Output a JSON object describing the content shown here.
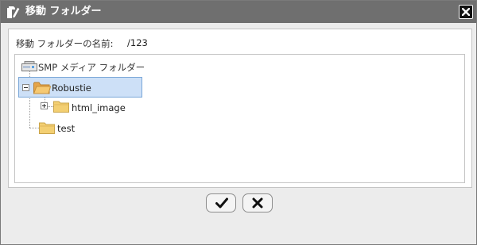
{
  "dialog": {
    "title": "移動 フォルダー",
    "name_label": "移動 フォルダーの名前:",
    "name_value": "/123"
  },
  "tree": {
    "root": {
      "label": "SMP メディア フォルダー",
      "icon": "drive-icon"
    },
    "nodes": [
      {
        "label": "Robustie",
        "icon": "folder-open-icon",
        "expanded": true,
        "selected": true
      },
      {
        "label": "html_image",
        "icon": "folder-icon",
        "expanded": false
      },
      {
        "label": "test",
        "icon": "folder-icon"
      }
    ]
  },
  "buttons": {
    "ok_icon": "checkmark-icon",
    "cancel_icon": "x-icon"
  },
  "colors": {
    "titlebar": "#6f6f6f",
    "selection": "#cde0f7",
    "folder": "#f3cf72"
  }
}
